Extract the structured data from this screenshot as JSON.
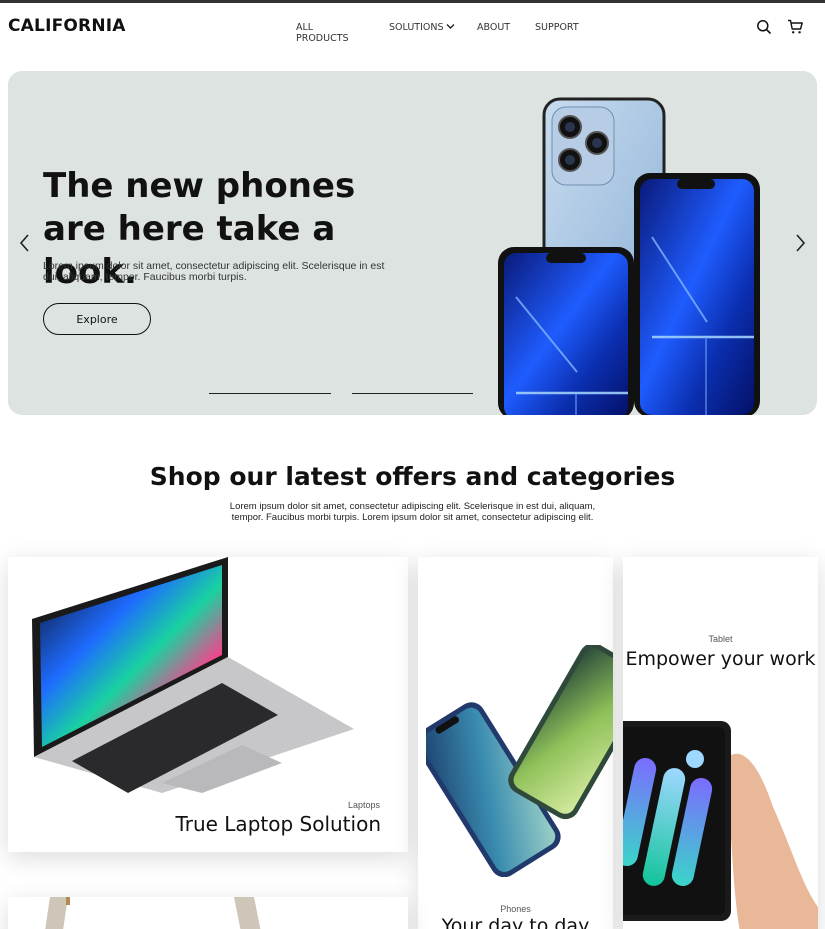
{
  "brand": {
    "logo_text": "CALIFORNIA"
  },
  "nav": {
    "items": [
      {
        "label": "ALL PRODUCTS"
      },
      {
        "label": "SOLUTIONS",
        "has_dropdown": true
      },
      {
        "label": "ABOUT"
      },
      {
        "label": "SUPPORT"
      }
    ]
  },
  "header_icons": [
    "search-icon",
    "cart-icon"
  ],
  "hero": {
    "title": "The new phones are here take a look.",
    "description": "Lorem ipsum dolor sit amet, consectetur adipiscing elit. Scelerisque in est dui, aliquam, tempor. Faucibus morbi turpis.",
    "cta_label": "Explore",
    "background_color": "#dde3e0",
    "slides_count": 2,
    "active_slide": 1
  },
  "offers": {
    "title": "Shop our latest offers and categories",
    "description": "Lorem ipsum dolor sit amet, consectetur adipiscing elit. Scelerisque in est dui, aliquam, tempor. Faucibus morbi turpis. Lorem ipsum dolor sit amet, consectetur adipiscing elit."
  },
  "categories": [
    {
      "category": "Laptops",
      "title": "True Laptop Solution"
    },
    {
      "category": "Phones",
      "title": "Your day to day"
    },
    {
      "category": "Tablet",
      "title": "Empower your work"
    }
  ]
}
